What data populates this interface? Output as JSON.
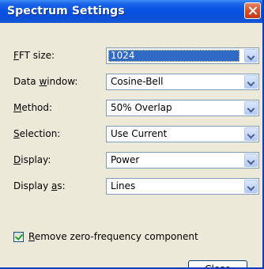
{
  "window": {
    "title": "Spectrum Settings"
  },
  "fields": [
    {
      "label_pre": "",
      "label_key": "F",
      "label_post": "FT size:",
      "value": "1024"
    },
    {
      "label_pre": "Data ",
      "label_key": "w",
      "label_post": "indow:",
      "value": "Cosine-Bell"
    },
    {
      "label_pre": "",
      "label_key": "M",
      "label_post": "ethod:",
      "value": "50% Overlap"
    },
    {
      "label_pre": "",
      "label_key": "S",
      "label_post": "election:",
      "value": "Use Current"
    },
    {
      "label_pre": "",
      "label_key": "D",
      "label_post": "isplay:",
      "value": "Power"
    },
    {
      "label_pre": "Display ",
      "label_key": "a",
      "label_post": "s:",
      "value": "Lines"
    }
  ],
  "remove_zero": {
    "key": "R",
    "rest": "emove zero-frequency component",
    "checked": true
  },
  "close_button": {
    "key": "C",
    "rest": "lose"
  },
  "icons": {
    "close": "close-icon",
    "dropdown": "chevron-down-icon",
    "check": "checkmark-icon"
  },
  "colors": {
    "titlebar": "#0a4fd9",
    "selection": "#316ac5",
    "dialog_bg": "#ece9d8"
  }
}
